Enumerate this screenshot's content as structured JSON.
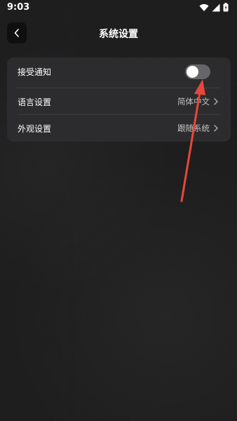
{
  "status_bar": {
    "time": "9:03"
  },
  "header": {
    "title": "系统设置"
  },
  "settings": {
    "notifications": {
      "label": "接受通知",
      "enabled": false
    },
    "language": {
      "label": "语言设置",
      "value": "简体中文"
    },
    "appearance": {
      "label": "外观设置",
      "value": "跟随系统"
    }
  },
  "colors": {
    "background": "#1d1d1d",
    "card": "#2c2c2e",
    "toggle_off": "#65656a",
    "annotation_arrow": "#e5483a"
  }
}
